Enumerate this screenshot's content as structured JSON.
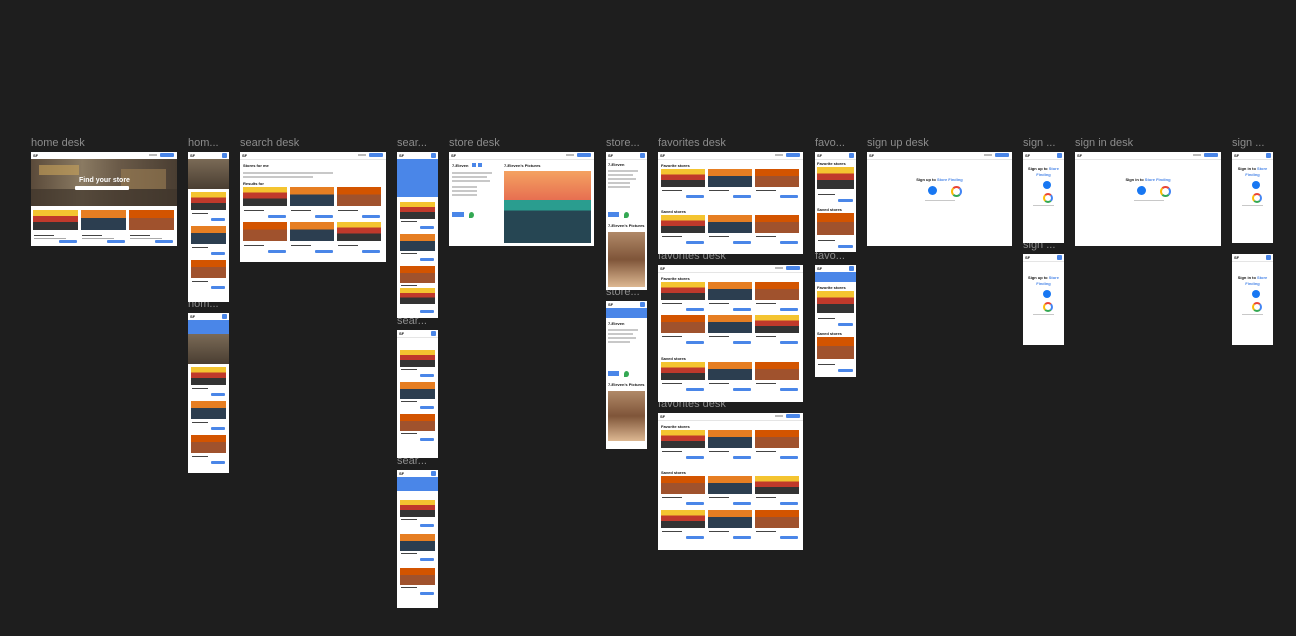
{
  "canvas_background": "#1e1e1e",
  "accent": "#4a86e8",
  "frame_labels": {
    "home_desk": "home desk",
    "home_mobile": "hom...",
    "home_mobile_2": "hom...",
    "search_desk": "search desk",
    "search_mobile": "sear...",
    "search_mobile_2": "sear...",
    "search_mobile_3": "sear...",
    "store_desk": "store desk",
    "store_mobile": "store...",
    "store_mobile_2": "store...",
    "favorites_desk": "favorites desk",
    "favorites_desk_2": "favorites desk",
    "favorites_desk_3": "favorites desk",
    "favorites_mobile": "favo...",
    "favorites_mobile_2": "favo...",
    "signup_desk": "sign up desk",
    "signup_mobile": "sign ...",
    "signup_mobile_2": "sign ...",
    "signin_desk": "sign in desk",
    "signin_mobile": "sign ..."
  },
  "brand": "SF",
  "home": {
    "hero_title": "Find your store"
  },
  "search": {
    "title": "Stores for me",
    "results": "Results for"
  },
  "store": {
    "name": "7-Eleven",
    "pictures": "7-Eleven's Pictures"
  },
  "favorites": {
    "favorite_stores": "Favorite stores",
    "saved_stores": "Saved stores"
  },
  "signup": {
    "prefix": "Sign up to ",
    "brand_link": "Store Finding"
  },
  "signin": {
    "prefix": "Sign in to ",
    "brand_link": "Store Finding"
  }
}
